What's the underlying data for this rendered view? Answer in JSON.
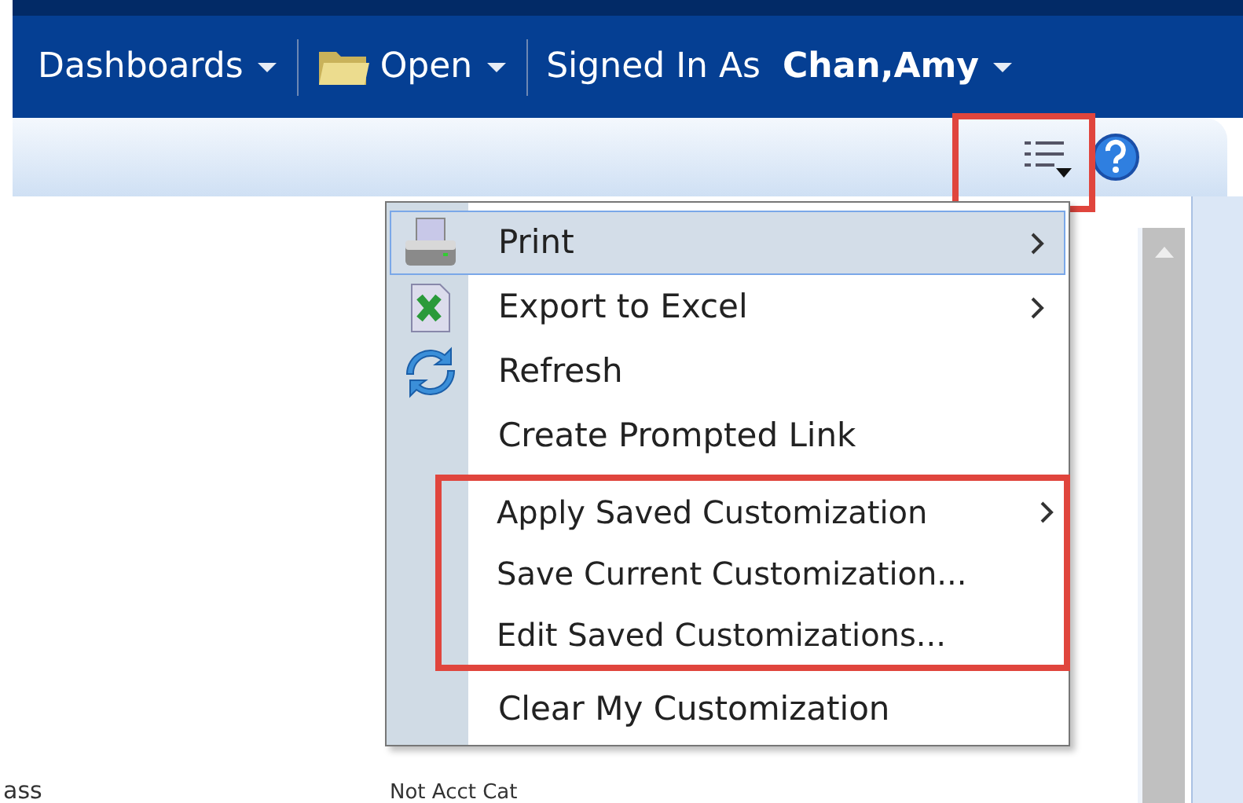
{
  "nav": [
    {
      "kind": "menu",
      "label": "Dashboards"
    },
    {
      "kind": "folder",
      "label": "Open"
    },
    {
      "kind": "user",
      "label": "Signed In As",
      "value": "Chan,Amy"
    }
  ],
  "menu": [
    {
      "label": "Print",
      "kind": "printer",
      "submenu": true,
      "selected": true,
      "highlighted": false
    },
    {
      "label": "Export to Excel",
      "kind": "excel",
      "submenu": true,
      "selected": false,
      "highlighted": false
    },
    {
      "label": "Refresh",
      "kind": "refresh",
      "submenu": false,
      "selected": false,
      "highlighted": false
    },
    {
      "label": "Create Prompted Link",
      "submenu": false,
      "selected": false,
      "highlighted": false
    },
    {
      "label": "Apply Saved Customization",
      "submenu": true,
      "selected": false,
      "highlighted": true
    },
    {
      "label": "Save Current Customization...",
      "submenu": false,
      "selected": false,
      "highlighted": true
    },
    {
      "label": "Edit Saved Customizations...",
      "submenu": false,
      "selected": false,
      "highlighted": true
    },
    {
      "label": "Clear My Customization",
      "submenu": false,
      "selected": false,
      "highlighted": false
    }
  ],
  "background_text": [
    "ass",
    "Not Acct Cat"
  ]
}
